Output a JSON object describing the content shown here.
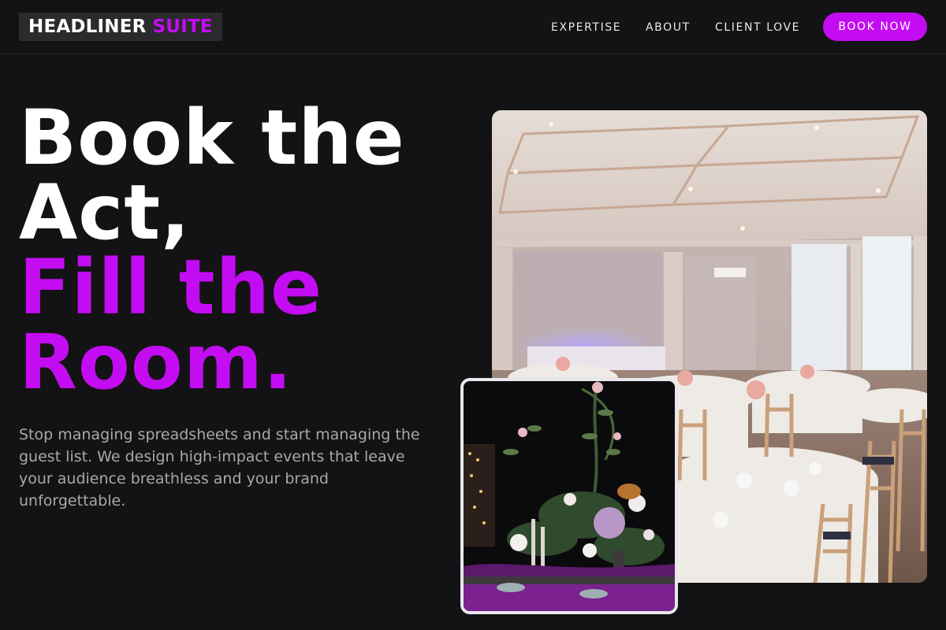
{
  "header": {
    "logo_primary": "HEADLINER",
    "logo_accent": "SUITE",
    "nav": [
      "EXPERTISE",
      "ABOUT",
      "CLIENT LOVE"
    ],
    "cta_label": "BOOK NOW"
  },
  "hero": {
    "headline_lines": [
      "Book the",
      "Act,",
      "Fill the",
      "Room."
    ],
    "subtext": "Stop managing spreadsheets and start managing the guest list. We design high-impact events that leave your audience breathless and your brand unforgettable."
  },
  "colors": {
    "accent": "#c40cf2",
    "background": "#131214",
    "body_text": "#a9a8ab"
  },
  "images": {
    "main": "banquet-hall-photo",
    "inset": "floral-centerpiece-photo"
  }
}
